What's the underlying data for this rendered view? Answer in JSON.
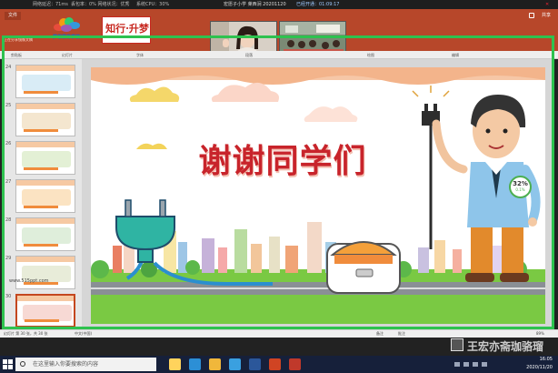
{
  "meeting_bar": {
    "network": "网络延迟：71ms",
    "packet_loss": "丢包率：0% 网络状况：优秀",
    "cpu": "系统CPU：30%",
    "title": "宏愿子小学 莱西涧 20201120",
    "duration": "已经开通：01:09:17",
    "close": "✕"
  },
  "ppt": {
    "file_tab": "文件",
    "share": "共享",
    "warn": "正在分享镜像文稿",
    "ribbon_groups": [
      "剪贴板",
      "幻灯片",
      "字体",
      "段落",
      "绘图",
      "编辑"
    ]
  },
  "logos": {
    "left_text": "梦想教育学校",
    "brand_text": "知行·升梦",
    "brand_sub": "ZHIXING SHENGMENG"
  },
  "video": {
    "teacher_label": "2003年班级"
  },
  "thumbnails": [
    {
      "num": "24",
      "color": "#d9ecf6"
    },
    {
      "num": "25",
      "color": "#f4e6cf"
    },
    {
      "num": "26",
      "color": "#e3f0d5"
    },
    {
      "num": "27",
      "color": "#fbe3c2"
    },
    {
      "num": "28",
      "color": "#dfeedb"
    },
    {
      "num": "29",
      "color": "#e8ecd9"
    },
    {
      "num": "30",
      "color": "#f7d9d4"
    }
  ],
  "slide": {
    "title": "谢谢同学们",
    "badge_value": "32%",
    "badge_sub": "0.1%"
  },
  "watermark": "www.515ppt.com",
  "status": {
    "slide_pos": "幻灯片 第 30 张，共 30 张",
    "lang": "中文(中国)",
    "notes": "备注",
    "comments": "批注",
    "zoom": "89%"
  },
  "corner_watermark": "王宏亦斋珈骆瑠",
  "taskbar": {
    "search_placeholder": "在这里输入你要搜索的内容",
    "time": "16:05",
    "date": "2020/11/20",
    "icon_colors": [
      "#ffd35c",
      "#2c8fd6",
      "#f0b73b",
      "#3aa0e0",
      "#2b579a",
      "#d04423",
      "#c0392b"
    ]
  }
}
